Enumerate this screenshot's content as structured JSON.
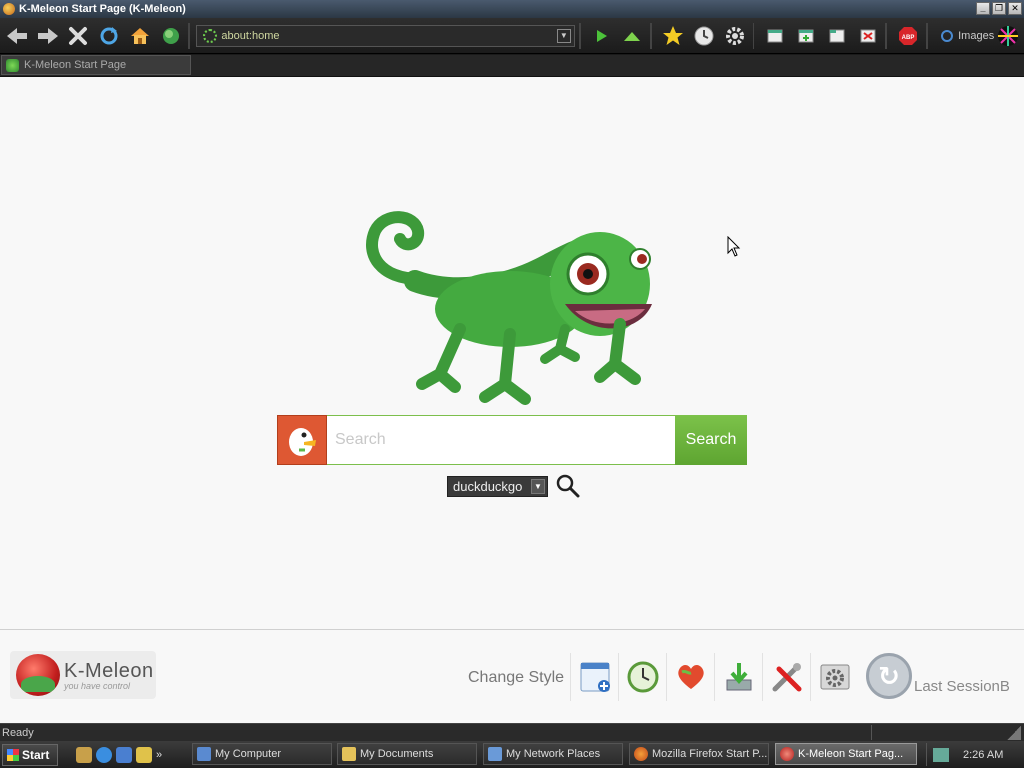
{
  "window": {
    "title": "K-Meleon Start Page (K-Meleon)",
    "btn_min": "_",
    "btn_restore": "❐",
    "btn_close": "✕"
  },
  "toolbar": {
    "url": "about:home",
    "images_label": "Images"
  },
  "tab": {
    "label": "K-Meleon Start Page"
  },
  "search": {
    "placeholder": "Search",
    "button_label": "Search",
    "engine": "duckduckgo"
  },
  "footer": {
    "logo_name": "K-Meleon",
    "logo_tagline": "you have control",
    "change_style": "Change Style",
    "last_session": "Last SessionB"
  },
  "status": {
    "text": "Ready"
  },
  "taskbar": {
    "start": "Start",
    "tasks": [
      {
        "label": "My Computer"
      },
      {
        "label": "My Documents"
      },
      {
        "label": "My Network Places"
      },
      {
        "label": "Mozilla Firefox Start P..."
      },
      {
        "label": "K-Meleon Start Pag..."
      }
    ],
    "clock": "2:26 AM"
  },
  "colors": {
    "accent_green": "#6db53d",
    "ddg_orange": "#de5833"
  }
}
